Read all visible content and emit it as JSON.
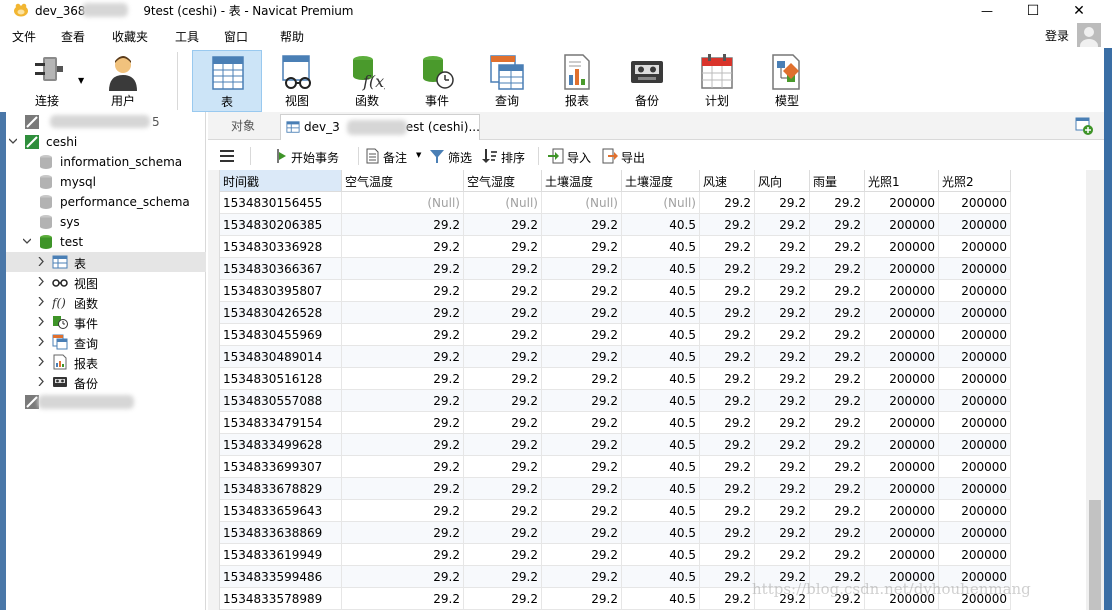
{
  "window": {
    "title_prefix": "dev_368",
    "title_suffix": "9test (ceshi) - 表 - Navicat Premium",
    "close_glyph": "✕",
    "min_glyph": "—",
    "max_glyph": "☐"
  },
  "menu": [
    "文件",
    "查看",
    "收藏夹",
    "工具",
    "窗口",
    "帮助"
  ],
  "login_label": "登录",
  "toolbar": [
    {
      "label": "连接",
      "icon": "plug-icon"
    },
    {
      "label": "用户",
      "icon": "user-icon"
    },
    {
      "label": "表",
      "icon": "table-icon",
      "active": true
    },
    {
      "label": "视图",
      "icon": "view-icon"
    },
    {
      "label": "函数",
      "icon": "function-icon"
    },
    {
      "label": "事件",
      "icon": "event-icon"
    },
    {
      "label": "查询",
      "icon": "query-icon"
    },
    {
      "label": "报表",
      "icon": "report-icon"
    },
    {
      "label": "备份",
      "icon": "backup-icon"
    },
    {
      "label": "计划",
      "icon": "schedule-icon"
    },
    {
      "label": "模型",
      "icon": "model-icon"
    }
  ],
  "sidebar": {
    "connection_top_suffix": "5",
    "items": [
      {
        "label": "ceshi",
        "type": "connection",
        "expanded": true
      },
      {
        "label": "information_schema",
        "type": "db"
      },
      {
        "label": "mysql",
        "type": "db"
      },
      {
        "label": "performance_schema",
        "type": "db"
      },
      {
        "label": "sys",
        "type": "db"
      },
      {
        "label": "test",
        "type": "db-open",
        "expanded": true
      },
      {
        "label": "表",
        "type": "table",
        "selected": true
      },
      {
        "label": "视图",
        "type": "view"
      },
      {
        "label": "函数",
        "type": "function"
      },
      {
        "label": "事件",
        "type": "event"
      },
      {
        "label": "查询",
        "type": "query"
      },
      {
        "label": "报表",
        "type": "report"
      },
      {
        "label": "备份",
        "type": "backup"
      }
    ]
  },
  "tabs": {
    "objects_label": "对象",
    "doc_prefix": "dev_3",
    "doc_suffix": "est (ceshi)..."
  },
  "object_toolbar": {
    "begin_tx": "开始事务",
    "note": "备注",
    "filter": "筛选",
    "sort": "排序",
    "import": "导入",
    "export": "导出"
  },
  "grid": {
    "columns": [
      "时间戳",
      "空气温度",
      "空气湿度",
      "土壤温度",
      "土壤湿度",
      "风速",
      "风向",
      "雨量",
      "光照1",
      "光照2"
    ],
    "null_text": "(Null)",
    "rows": [
      [
        "1534830156455",
        null,
        null,
        null,
        null,
        "29.2",
        "29.2",
        "29.2",
        "200000",
        "200000"
      ],
      [
        "1534830206385",
        "29.2",
        "29.2",
        "29.2",
        "40.5",
        "29.2",
        "29.2",
        "29.2",
        "200000",
        "200000"
      ],
      [
        "1534830336928",
        "29.2",
        "29.2",
        "29.2",
        "40.5",
        "29.2",
        "29.2",
        "29.2",
        "200000",
        "200000"
      ],
      [
        "1534830366367",
        "29.2",
        "29.2",
        "29.2",
        "40.5",
        "29.2",
        "29.2",
        "29.2",
        "200000",
        "200000"
      ],
      [
        "1534830395807",
        "29.2",
        "29.2",
        "29.2",
        "40.5",
        "29.2",
        "29.2",
        "29.2",
        "200000",
        "200000"
      ],
      [
        "1534830426528",
        "29.2",
        "29.2",
        "29.2",
        "40.5",
        "29.2",
        "29.2",
        "29.2",
        "200000",
        "200000"
      ],
      [
        "1534830455969",
        "29.2",
        "29.2",
        "29.2",
        "40.5",
        "29.2",
        "29.2",
        "29.2",
        "200000",
        "200000"
      ],
      [
        "1534830489014",
        "29.2",
        "29.2",
        "29.2",
        "40.5",
        "29.2",
        "29.2",
        "29.2",
        "200000",
        "200000"
      ],
      [
        "1534830516128",
        "29.2",
        "29.2",
        "29.2",
        "40.5",
        "29.2",
        "29.2",
        "29.2",
        "200000",
        "200000"
      ],
      [
        "1534830557088",
        "29.2",
        "29.2",
        "29.2",
        "40.5",
        "29.2",
        "29.2",
        "29.2",
        "200000",
        "200000"
      ],
      [
        "1534833479154",
        "29.2",
        "29.2",
        "29.2",
        "40.5",
        "29.2",
        "29.2",
        "29.2",
        "200000",
        "200000"
      ],
      [
        "1534833499628",
        "29.2",
        "29.2",
        "29.2",
        "40.5",
        "29.2",
        "29.2",
        "29.2",
        "200000",
        "200000"
      ],
      [
        "1534833699307",
        "29.2",
        "29.2",
        "29.2",
        "40.5",
        "29.2",
        "29.2",
        "29.2",
        "200000",
        "200000"
      ],
      [
        "1534833678829",
        "29.2",
        "29.2",
        "29.2",
        "40.5",
        "29.2",
        "29.2",
        "29.2",
        "200000",
        "200000"
      ],
      [
        "1534833659643",
        "29.2",
        "29.2",
        "29.2",
        "40.5",
        "29.2",
        "29.2",
        "29.2",
        "200000",
        "200000"
      ],
      [
        "1534833638869",
        "29.2",
        "29.2",
        "29.2",
        "40.5",
        "29.2",
        "29.2",
        "29.2",
        "200000",
        "200000"
      ],
      [
        "1534833619949",
        "29.2",
        "29.2",
        "29.2",
        "40.5",
        "29.2",
        "29.2",
        "29.2",
        "200000",
        "200000"
      ],
      [
        "1534833599486",
        "29.2",
        "29.2",
        "29.2",
        "40.5",
        "29.2",
        "29.2",
        "29.2",
        "200000",
        "200000"
      ],
      [
        "1534833578989",
        "29.2",
        "29.2",
        "29.2",
        "40.5",
        "29.2",
        "29.2",
        "29.2",
        "200000",
        "200000"
      ]
    ]
  },
  "watermark": "https://blog.csdn.net/dyhouhenmang",
  "colors": {
    "accent": "#cce4f7",
    "selected_header": "#dbe9f8",
    "null_text": "#a0a0a0"
  }
}
